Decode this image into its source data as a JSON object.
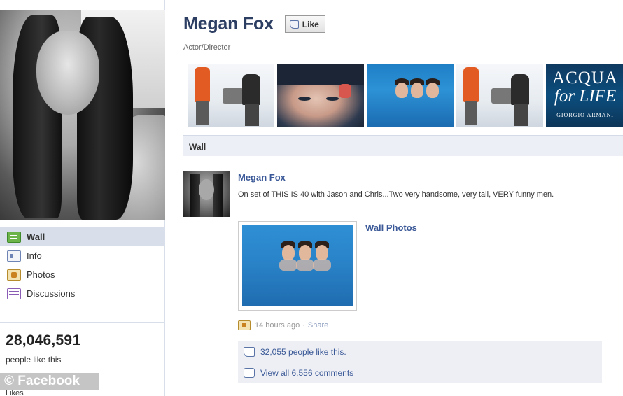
{
  "profile": {
    "name": "Megan Fox",
    "like_button": "Like",
    "category": "Actor/Director"
  },
  "sidebar": {
    "items": [
      {
        "label": "Wall",
        "icon": "wall-icon",
        "active": true
      },
      {
        "label": "Info",
        "icon": "info-icon",
        "active": false
      },
      {
        "label": "Photos",
        "icon": "photos-icon",
        "active": false
      },
      {
        "label": "Discussions",
        "icon": "discussions-icon",
        "active": false
      }
    ],
    "likes_count": "28,046,591",
    "likes_label": "people like this",
    "likes_cut_label": "Likes",
    "watermark": "© Facebook"
  },
  "photo_strip": {
    "acqua_line1": "ACQUA",
    "acqua_line2": "for LIFE",
    "acqua_line3": "GIORGIO ARMANI"
  },
  "wall_tab": "Wall",
  "post": {
    "author": "Megan Fox",
    "text": "On set of THIS IS 40 with Jason and Chris...Two very handsome, very tall, VERY funny men.",
    "attachment_title": "Wall Photos",
    "time": "14 hours ago",
    "separator": "·",
    "share": "Share",
    "likes_text": "32,055 people like this.",
    "comments_text": "View all 6,556 comments"
  },
  "colors": {
    "link": "#3b5998",
    "title": "#2d3e63",
    "active_nav_bg": "#d8dfea",
    "feedback_bg": "#edeff4"
  }
}
